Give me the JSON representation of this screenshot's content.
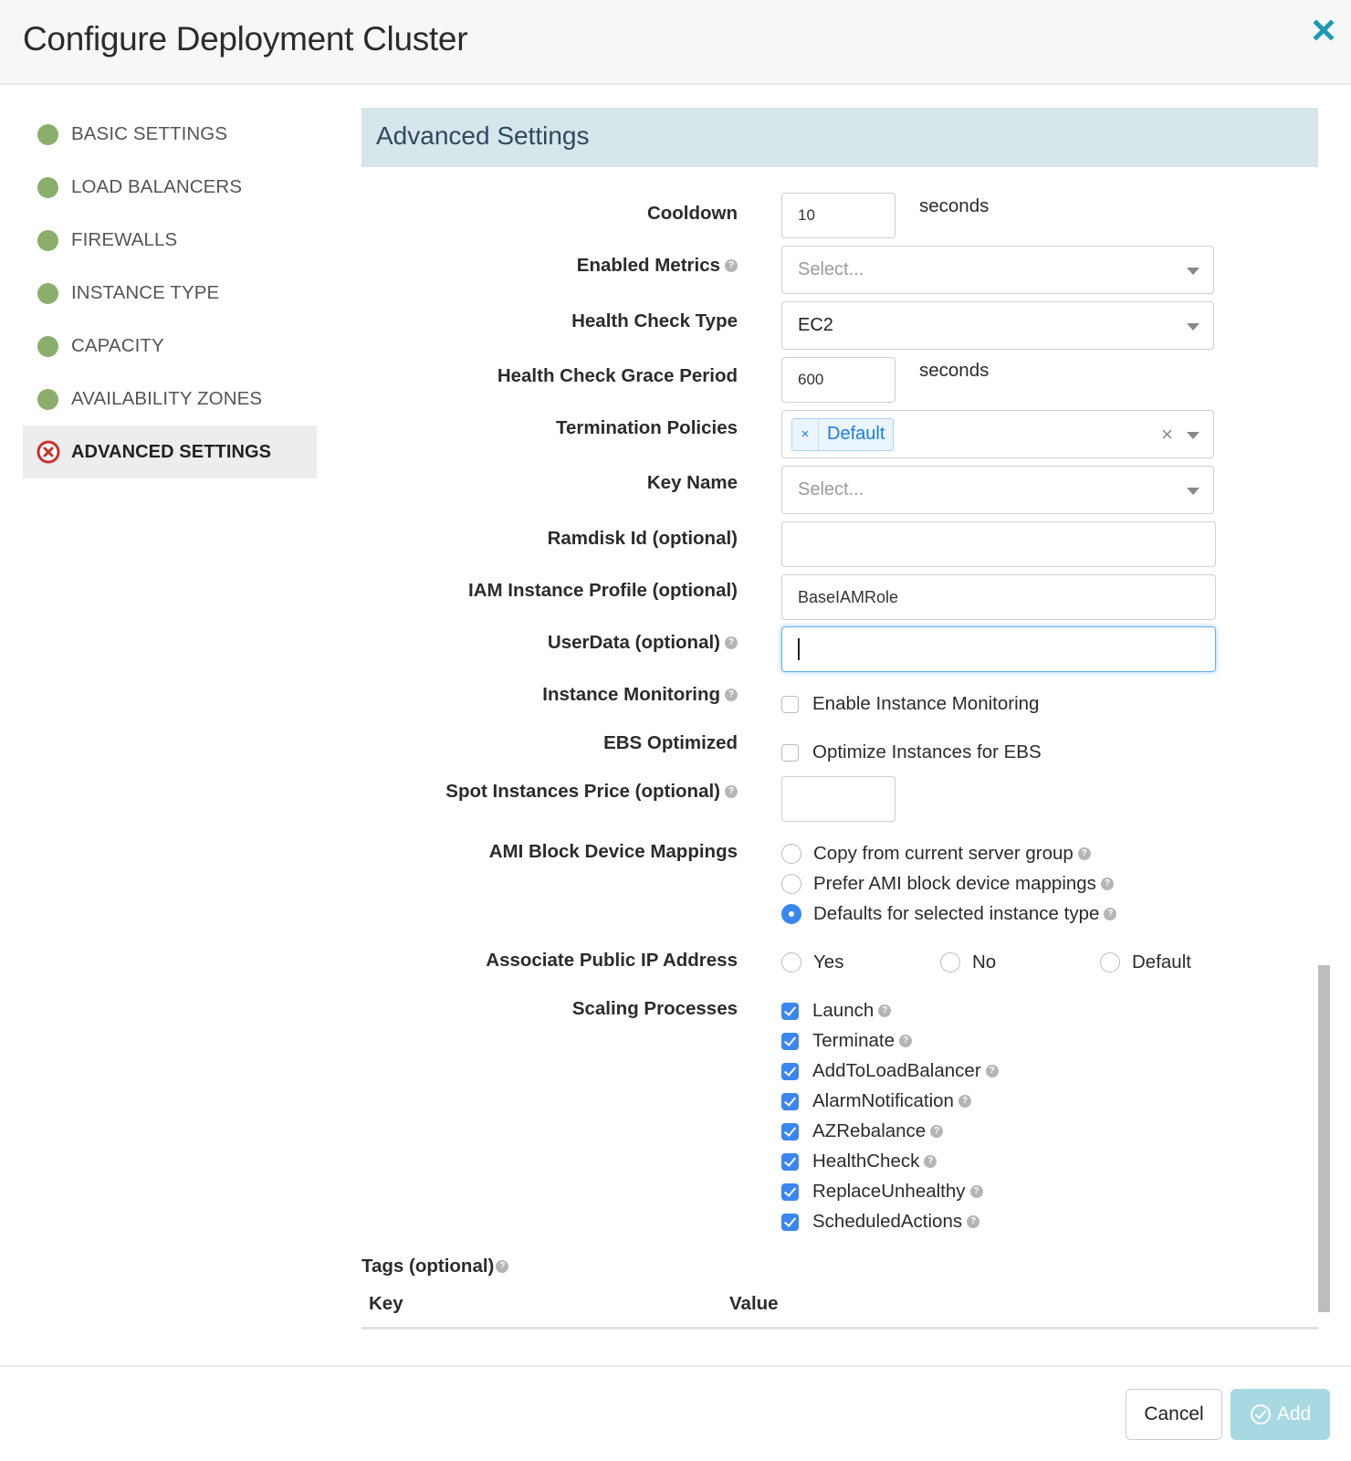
{
  "dialog": {
    "title": "Configure Deployment Cluster",
    "close_icon": "close-icon",
    "accent_color": "#1a9bb3"
  },
  "sidebar": {
    "items": [
      {
        "label": "BASIC SETTINGS",
        "status": "complete"
      },
      {
        "label": "LOAD BALANCERS",
        "status": "complete"
      },
      {
        "label": "FIREWALLS",
        "status": "complete"
      },
      {
        "label": "INSTANCE TYPE",
        "status": "complete"
      },
      {
        "label": "CAPACITY",
        "status": "complete"
      },
      {
        "label": "AVAILABILITY ZONES",
        "status": "complete"
      },
      {
        "label": "ADVANCED SETTINGS",
        "status": "error",
        "active": true
      }
    ],
    "complete_color": "#8aae6c",
    "error_color": "#c9302c"
  },
  "section": {
    "title": "Advanced Settings"
  },
  "form": {
    "cooldown": {
      "label": "Cooldown",
      "value": "10",
      "suffix": "seconds"
    },
    "enabled_metrics": {
      "label": "Enabled Metrics",
      "placeholder": "Select...",
      "help": true
    },
    "health_check_type": {
      "label": "Health Check Type",
      "value": "EC2"
    },
    "health_check_grace": {
      "label": "Health Check Grace Period",
      "value": "600",
      "suffix": "seconds"
    },
    "termination_policies": {
      "label": "Termination Policies",
      "tags": [
        "Default"
      ],
      "tag_remove": "×",
      "clear": "×"
    },
    "key_name": {
      "label": "Key Name",
      "placeholder": "Select..."
    },
    "ramdisk_id": {
      "label": "Ramdisk Id (optional)",
      "value": ""
    },
    "iam_profile": {
      "label": "IAM Instance Profile (optional)",
      "value": "BaseIAMRole"
    },
    "user_data": {
      "label": "UserData (optional)",
      "value": "",
      "focused": true,
      "help": true
    },
    "instance_monitoring": {
      "label": "Instance Monitoring",
      "option": "Enable Instance Monitoring",
      "checked": false,
      "help": true
    },
    "ebs_optimized": {
      "label": "EBS Optimized",
      "option": "Optimize Instances for EBS",
      "checked": false
    },
    "spot_price": {
      "label": "Spot Instances Price (optional)",
      "value": "",
      "help": true
    },
    "ami_block": {
      "label": "AMI Block Device Mappings",
      "options": [
        {
          "label": "Copy from current server group",
          "selected": false
        },
        {
          "label": "Prefer AMI block device mappings",
          "selected": false
        },
        {
          "label": "Defaults for selected instance type",
          "selected": true
        }
      ]
    },
    "public_ip": {
      "label": "Associate Public IP Address",
      "options": [
        {
          "label": "Yes",
          "selected": false
        },
        {
          "label": "No",
          "selected": false
        },
        {
          "label": "Default",
          "selected": false
        }
      ]
    },
    "scaling_processes": {
      "label": "Scaling Processes",
      "items": [
        {
          "label": "Launch",
          "checked": true
        },
        {
          "label": "Terminate",
          "checked": true
        },
        {
          "label": "AddToLoadBalancer",
          "checked": true
        },
        {
          "label": "AlarmNotification",
          "checked": true
        },
        {
          "label": "AZRebalance",
          "checked": true
        },
        {
          "label": "HealthCheck",
          "checked": true
        },
        {
          "label": "ReplaceUnhealthy",
          "checked": true
        },
        {
          "label": "ScheduledActions",
          "checked": true
        }
      ]
    }
  },
  "tags": {
    "title": "Tags (optional)",
    "columns": [
      "Key",
      "Value"
    ]
  },
  "footer": {
    "cancel_label": "Cancel",
    "add_label": "Add",
    "add_enabled": false
  },
  "help_glyph": "?"
}
